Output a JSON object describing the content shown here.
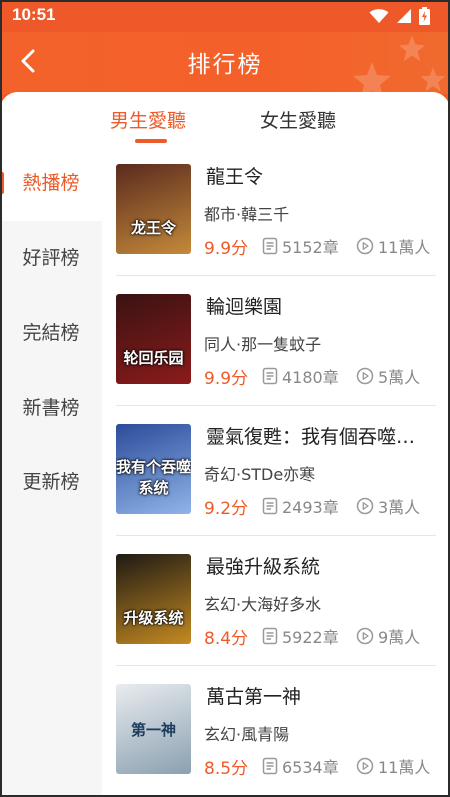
{
  "status_bar": {
    "time": "10:51"
  },
  "header": {
    "title": "排行榜"
  },
  "tabs": [
    {
      "label": "男生愛聽",
      "active": true
    },
    {
      "label": "女生愛聽",
      "active": false
    }
  ],
  "sidebar": {
    "items": [
      {
        "label": "熱播榜",
        "active": true
      },
      {
        "label": "好評榜",
        "active": false
      },
      {
        "label": "完結榜",
        "active": false
      },
      {
        "label": "新書榜",
        "active": false
      },
      {
        "label": "更新榜",
        "active": false
      }
    ]
  },
  "books": [
    {
      "title": "龍王令",
      "meta": "都市·韓三千",
      "score": "9.9分",
      "chapters": "5152章",
      "listeners": "11萬人",
      "cover_text": "龙王令",
      "cover_colors": [
        "#5a2a1e",
        "#c48a3a"
      ]
    },
    {
      "title": "輪迴樂園",
      "meta": "同人·那一隻蚊子",
      "score": "9.9分",
      "chapters": "4180章",
      "listeners": "5萬人",
      "cover_text": "轮回乐园",
      "cover_colors": [
        "#3a1212",
        "#8c1b1b"
      ]
    },
    {
      "title": "靈氣復甦：我有個吞噬…",
      "meta": "奇幻·STDe亦寒",
      "score": "9.2分",
      "chapters": "2493章",
      "listeners": "3萬人",
      "cover_text": "我有个吞噬系统",
      "cover_colors": [
        "#2c4c9a",
        "#8fb4e8"
      ]
    },
    {
      "title": "最強升級系統",
      "meta": "玄幻·大海好多水",
      "score": "8.4分",
      "chapters": "5922章",
      "listeners": "9萬人",
      "cover_text": "升级系统",
      "cover_colors": [
        "#1e1a14",
        "#c58a22"
      ]
    },
    {
      "title": "萬古第一神",
      "meta": "玄幻·風青陽",
      "score": "8.5分",
      "chapters": "6534章",
      "listeners": "11萬人",
      "cover_text": "第一神",
      "cover_colors": [
        "#e9ecef",
        "#8aa0b0"
      ]
    }
  ],
  "colors": {
    "accent": "#ee5b2b",
    "header": "#f3622a"
  },
  "icons": {
    "back": "chevron-left-icon",
    "chapters": "document-icon",
    "listeners": "play-circle-icon"
  }
}
